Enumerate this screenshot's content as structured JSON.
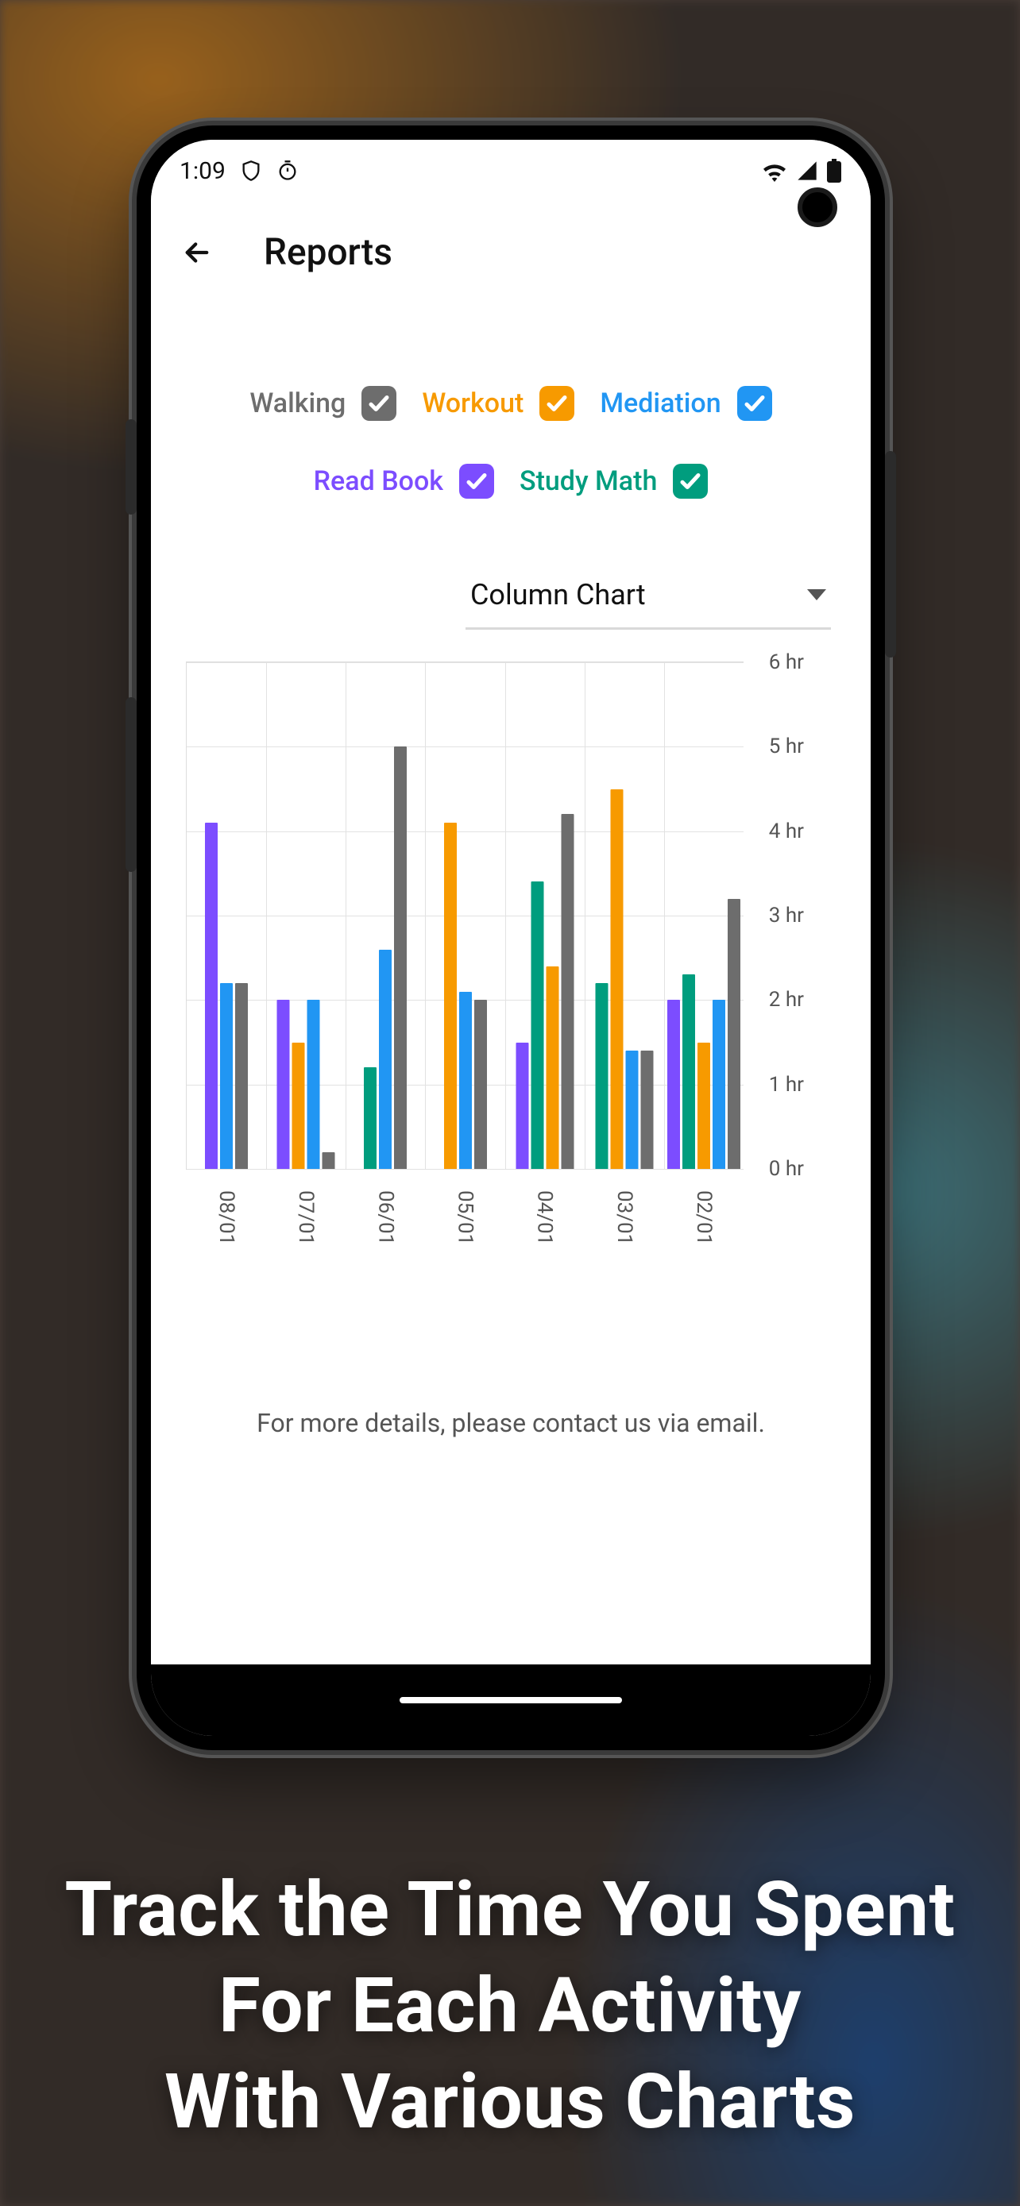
{
  "status": {
    "time": "1:09"
  },
  "appbar": {
    "title": "Reports"
  },
  "legend": [
    {
      "name": "Walking",
      "color": "#6d6d6d",
      "chk": "#6d6d6d"
    },
    {
      "name": "Workout",
      "color": "#f79a00",
      "chk": "#f79a00"
    },
    {
      "name": "Mediation",
      "color": "#2196f3",
      "chk": "#2196f3"
    },
    {
      "name": "Read Book",
      "color": "#7c4dff",
      "chk": "#7c4dff"
    },
    {
      "name": "Study Math",
      "color": "#009d7e",
      "chk": "#009d7e"
    }
  ],
  "dropdown": {
    "value": "Column Chart"
  },
  "footer_note": "For more details, please contact us via email.",
  "promo_lines": [
    "Track the Time You Spent",
    "For Each Activity",
    "With Various Charts"
  ],
  "chart_data": {
    "type": "bar",
    "ylabel": "",
    "xlabel": "",
    "ylim": [
      0,
      6
    ],
    "y_ticks": [
      0,
      1,
      2,
      3,
      4,
      5,
      6
    ],
    "y_tick_labels": [
      "0 hr",
      "1 hr",
      "2 hr",
      "3 hr",
      "4 hr",
      "5 hr",
      "6 hr"
    ],
    "y_unit": "hr",
    "categories": [
      "08/01",
      "07/01",
      "06/01",
      "05/01",
      "04/01",
      "03/01",
      "02/01"
    ],
    "series_order": [
      "Read Book",
      "Study Math",
      "Workout",
      "Mediation",
      "Walking"
    ],
    "series_colors": {
      "Walking": "#6d6d6d",
      "Workout": "#f79a00",
      "Mediation": "#2196f3",
      "Read Book": "#7c4dff",
      "Study Math": "#009d7e"
    },
    "series": [
      {
        "name": "Walking",
        "values": [
          2.2,
          0.2,
          5.0,
          2.0,
          4.2,
          1.4,
          3.2
        ]
      },
      {
        "name": "Workout",
        "values": [
          0.0,
          1.5,
          0.0,
          4.1,
          2.4,
          4.5,
          1.5
        ]
      },
      {
        "name": "Mediation",
        "values": [
          2.2,
          2.0,
          2.6,
          2.1,
          0.0,
          1.4,
          2.0
        ]
      },
      {
        "name": "Read Book",
        "values": [
          4.1,
          2.0,
          0.0,
          0.0,
          1.5,
          0.0,
          2.0
        ]
      },
      {
        "name": "Study Math",
        "values": [
          0.0,
          0.0,
          1.2,
          0.0,
          3.4,
          2.2,
          2.3
        ]
      }
    ]
  }
}
